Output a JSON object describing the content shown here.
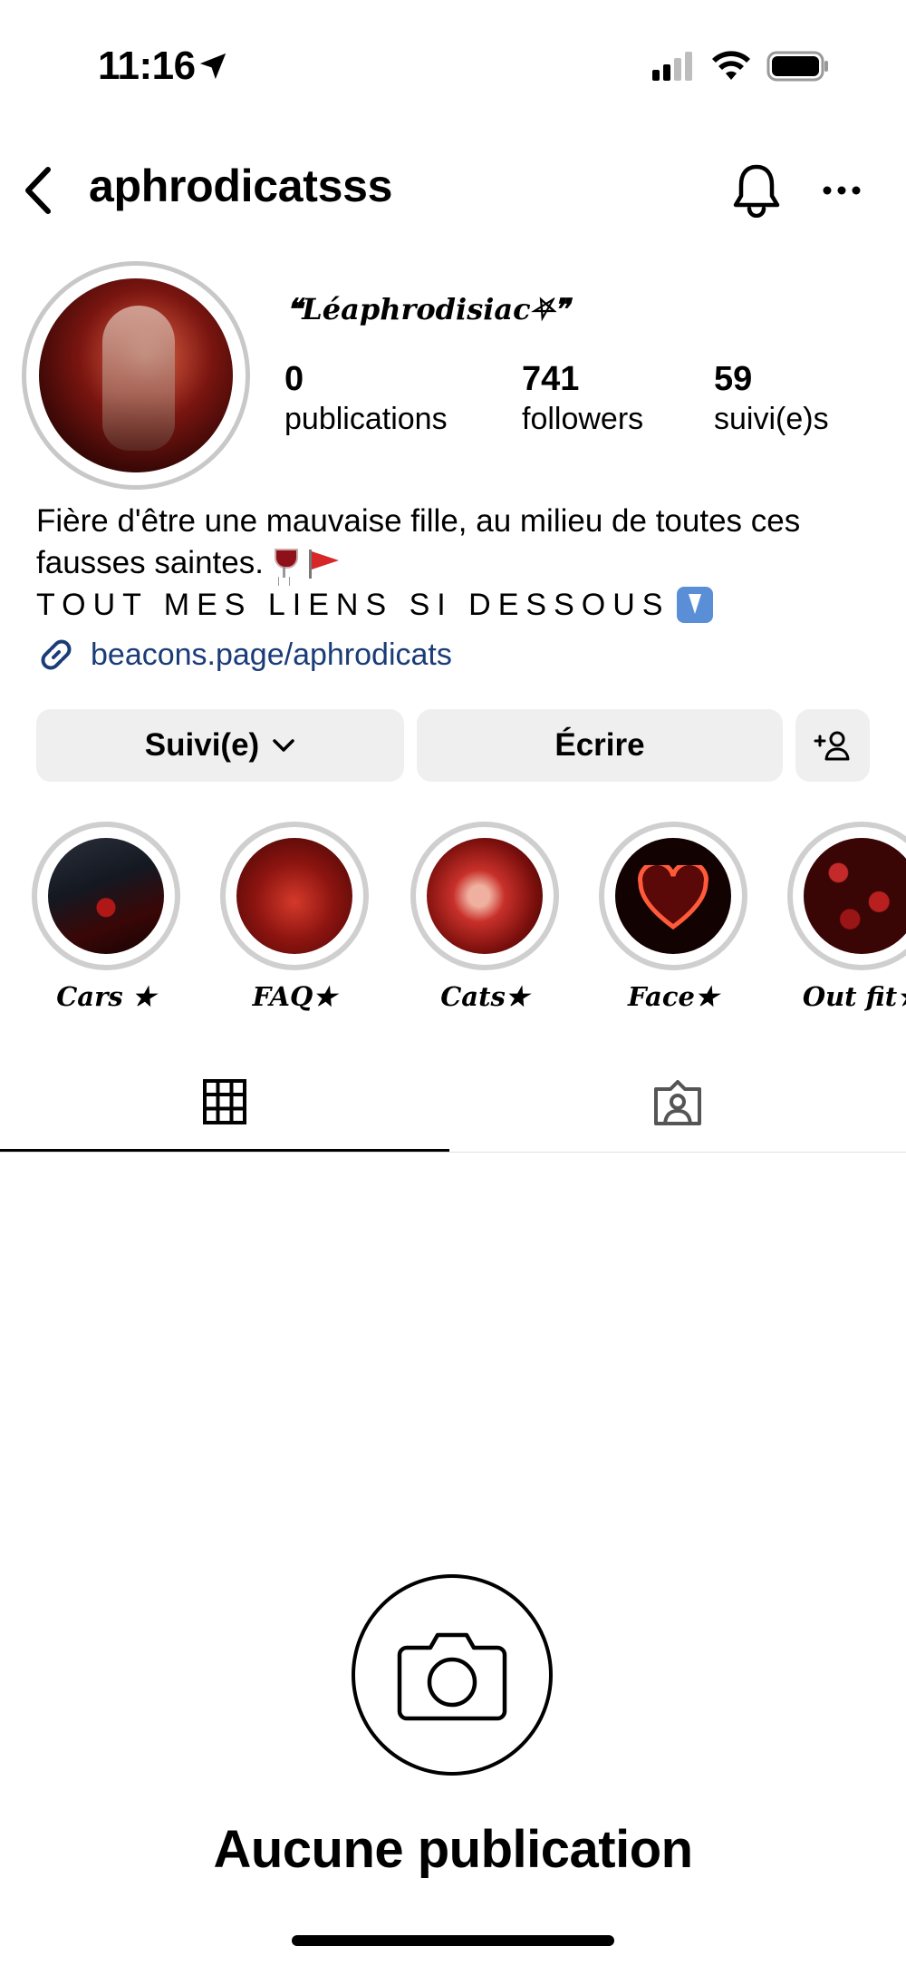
{
  "status_bar": {
    "time": "11:16",
    "icons": [
      "location-arrow-icon",
      "cellular-signal-icon",
      "wifi-icon",
      "battery-icon"
    ]
  },
  "header": {
    "username": "aphrodicatsss",
    "icons": [
      "back-chevron-icon",
      "bell-icon",
      "more-horizontal-icon"
    ]
  },
  "profile": {
    "display_name": "❝Léaphrodisiac⛧❞",
    "stats": [
      {
        "value": "0",
        "label": "publications"
      },
      {
        "value": "741",
        "label": "followers"
      },
      {
        "value": "59",
        "label": "suivi(e)s"
      }
    ],
    "bio": {
      "line1": "Fière d'être une mauvaise fille, au milieu de toutes ces",
      "line2": "fausses saintes.",
      "line3": "TOUT MES LIENS SI DESSOUS"
    },
    "link": "beacons.page/aphrodicats"
  },
  "actions": {
    "follow_label": "Suivi(e)",
    "message_label": "Écrire",
    "add_user_icon": "add-person-icon"
  },
  "highlights": [
    {
      "label": "Cars ★"
    },
    {
      "label": "FAQ★"
    },
    {
      "label": "Cats★"
    },
    {
      "label": "Face★"
    },
    {
      "label": "Out fit★"
    }
  ],
  "tabs": [
    "grid-icon",
    "tagged-icon"
  ],
  "empty_state": {
    "title": "Aucune publication",
    "icon": "camera-icon"
  },
  "colors": {
    "link": "#1a3c78",
    "button_bg": "#efefef",
    "ring": "#cfcfcf"
  }
}
